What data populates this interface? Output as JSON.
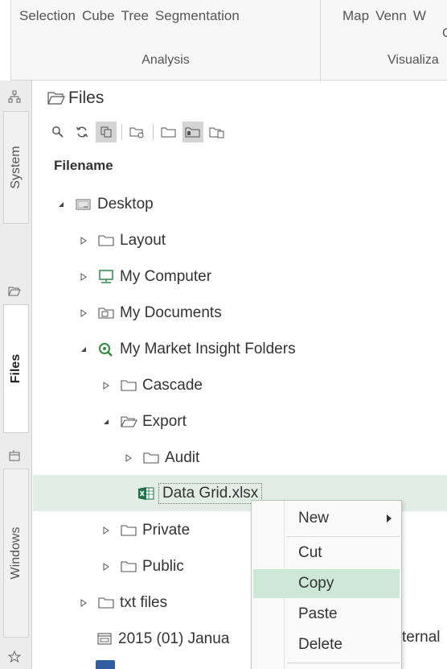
{
  "ribbon": {
    "analysis": {
      "buttons": [
        "Selection",
        "Cube",
        "Tree",
        "Segmentation"
      ],
      "label": "Analysis"
    },
    "visualization": {
      "buttons": [
        "Map",
        "Venn",
        "W"
      ],
      "sub": "C",
      "label": "Visualiza"
    }
  },
  "side_tabs": {
    "system": "System",
    "files": "Files",
    "windows": "Windows"
  },
  "panel": {
    "title": "Files",
    "column_header": "Filename"
  },
  "tree": [
    {
      "label": "Desktop"
    },
    {
      "label": "Layout"
    },
    {
      "label": "My Computer"
    },
    {
      "label": "My Documents"
    },
    {
      "label": "My Market Insight Folders"
    },
    {
      "label": "Cascade"
    },
    {
      "label": "Export"
    },
    {
      "label": "Audit"
    },
    {
      "label": "Data Grid.xlsx"
    },
    {
      "label": "Private"
    },
    {
      "label": "Public"
    },
    {
      "label": "txt files"
    },
    {
      "label": "2015 (01) Janua"
    }
  ],
  "context_menu": {
    "items": [
      "New",
      "Cut",
      "Copy",
      "Paste",
      "Delete"
    ],
    "hovered": "Copy"
  },
  "background_fragment": "ternal",
  "colors": {
    "selected_row": "#e2ede8",
    "menu_hover": "#cde8d7",
    "excel_green": "#1e7145",
    "search_green": "#2e8b3a",
    "computer_green": "#2b8a4b"
  }
}
